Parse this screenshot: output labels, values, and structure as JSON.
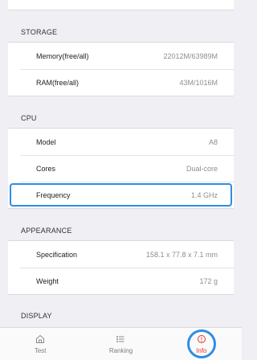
{
  "sections": {
    "storage": {
      "header": "STORAGE",
      "rows": [
        {
          "label": "Memory(free/all)",
          "value": "22012M/63989M"
        },
        {
          "label": "RAM(free/all)",
          "value": "43M/1016M"
        }
      ]
    },
    "cpu": {
      "header": "CPU",
      "rows": [
        {
          "label": "Model",
          "value": "A8"
        },
        {
          "label": "Cores",
          "value": "Dual-core"
        },
        {
          "label": "Frequency",
          "value": "1.4 GHz"
        }
      ]
    },
    "appearance": {
      "header": "APPEARANCE",
      "rows": [
        {
          "label": "Specification",
          "value": "158.1 x 77.8 x 7.1 mm"
        },
        {
          "label": "Weight",
          "value": "172 g"
        }
      ]
    },
    "display": {
      "header": "DISPLAY"
    }
  },
  "tabbar": {
    "items": [
      {
        "label": "Test",
        "icon": "home-icon"
      },
      {
        "label": "Ranking",
        "icon": "list-icon"
      },
      {
        "label": "Info",
        "icon": "info-icon",
        "active": true
      }
    ]
  }
}
